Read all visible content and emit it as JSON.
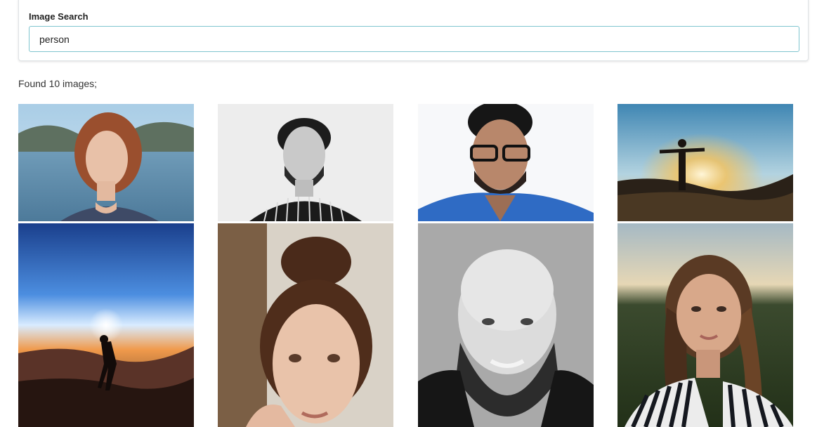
{
  "search": {
    "label": "Image Search",
    "value": "person"
  },
  "results": {
    "summary": "Found 10 images;"
  },
  "images": [
    {
      "subject": "woman-red-hair-lake"
    },
    {
      "subject": "man-curly-hair-striped-shirt-bw"
    },
    {
      "subject": "man-glasses-blue-shirt"
    },
    {
      "subject": "silhouette-arms-outstretched-sunset"
    },
    {
      "subject": "silhouette-sunset-hills"
    },
    {
      "subject": "woman-bun-freckles"
    },
    {
      "subject": "bald-man-beard-bw"
    },
    {
      "subject": "woman-striped-shirt-golden-hour"
    }
  ]
}
